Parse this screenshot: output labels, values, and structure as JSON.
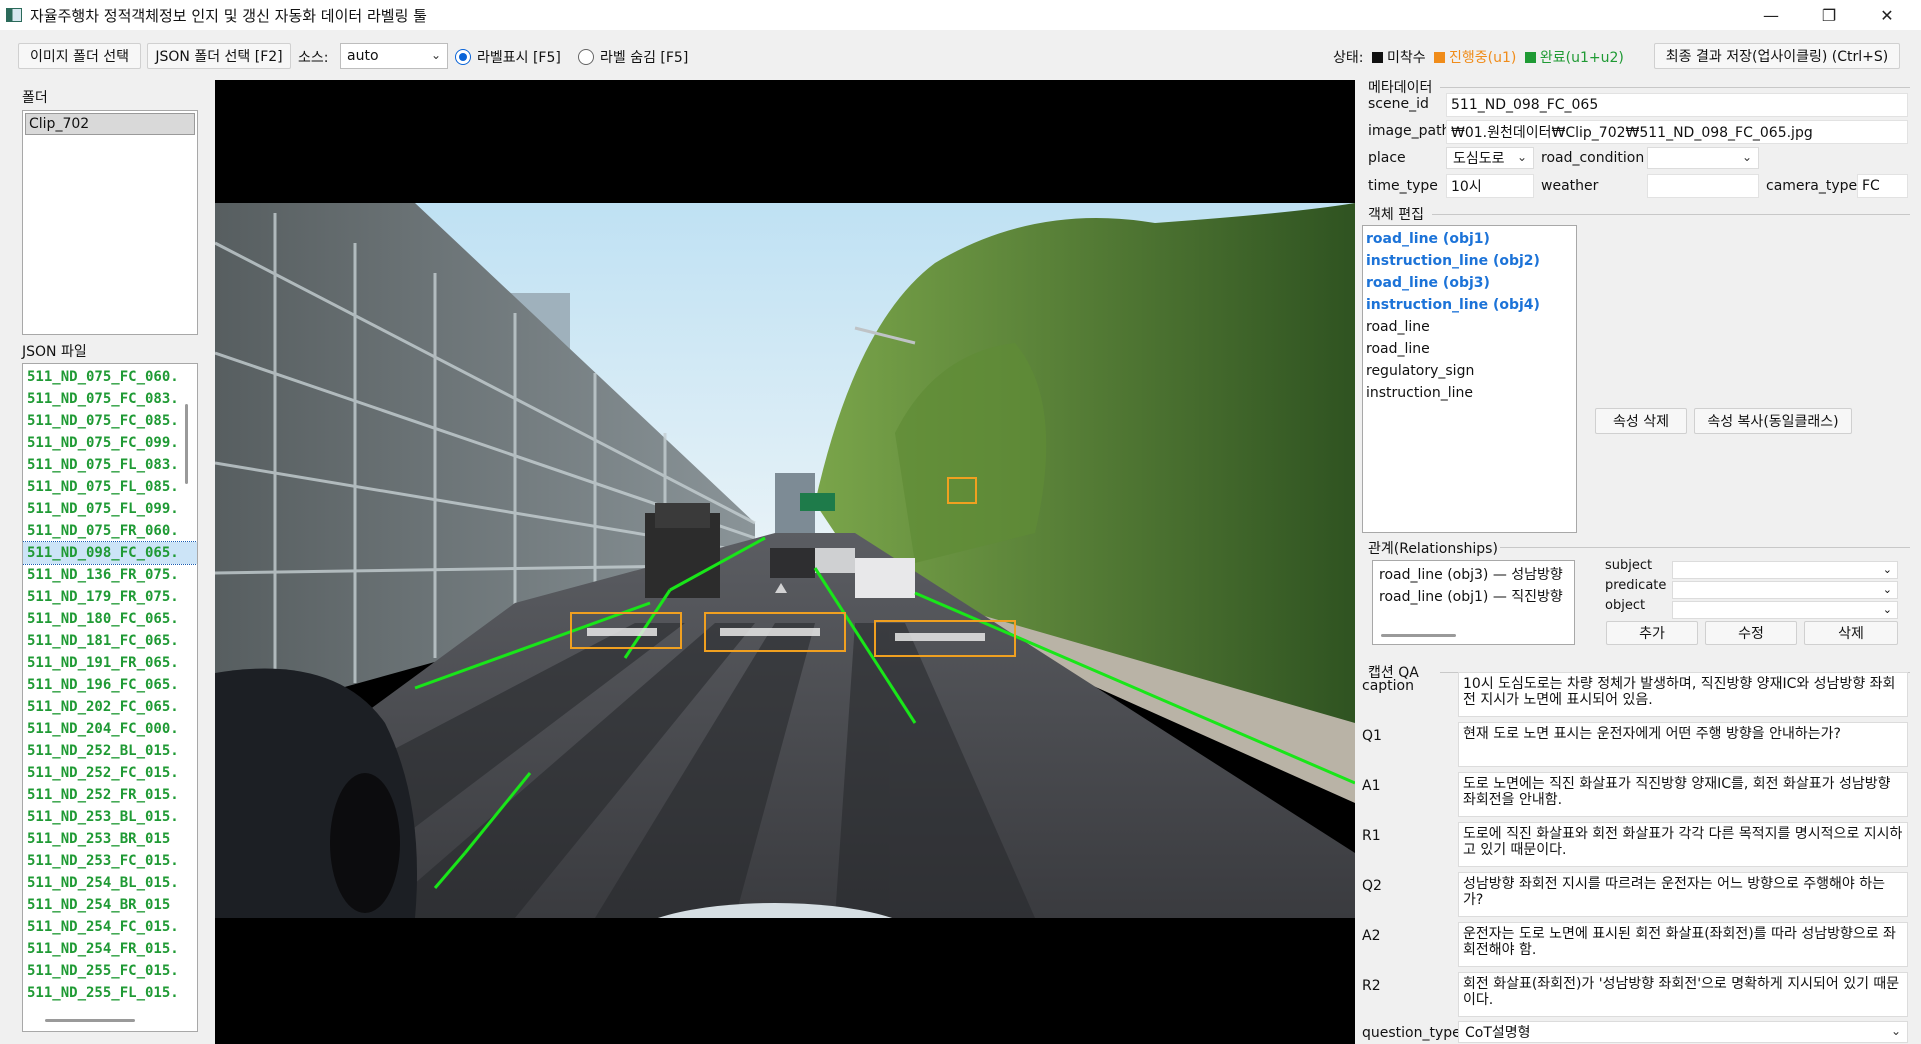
{
  "window": {
    "title": "자율주행차 정적객체정보 인지 및 갱신 자동화 데이터 라벨링 툴",
    "minimize": "—",
    "restore": "❐",
    "close": "✕"
  },
  "toolbar": {
    "image_folder_button": "이미지 폴더 선택",
    "json_folder_button": "JSON 폴더 선택 [F2]",
    "source_label": "소스:",
    "source_value": "auto",
    "radio_show": "라벨표시 [F5]",
    "radio_hide": "라벨 숨김 [F5]",
    "status_label": "상태:",
    "status_todo": "미착수",
    "status_progress": "진행중(u1)",
    "status_done": "완료(u1+u2)",
    "save_button": "최종 결과 저장(업사이클링) (Ctrl+S)",
    "colors": {
      "todo": "#111111",
      "progress": "#f08c1a",
      "done": "#1f9a34",
      "radio_on": "#0a64d8"
    }
  },
  "left": {
    "folder_label": "폴더",
    "folders": [
      "Clip_702"
    ],
    "json_label": "JSON 파일",
    "json_files": [
      "511_ND_075_FC_060.",
      "511_ND_075_FC_083.",
      "511_ND_075_FC_085.",
      "511_ND_075_FC_099.",
      "511_ND_075_FL_083.",
      "511_ND_075_FL_085.",
      "511_ND_075_FL_099.",
      "511_ND_075_FR_060.",
      "511_ND_098_FC_065.",
      "511_ND_136_FR_075.",
      "511_ND_179_FR_075.",
      "511_ND_180_FC_065.",
      "511_ND_181_FC_065.",
      "511_ND_191_FR_065.",
      "511_ND_196_FC_065.",
      "511_ND_202_FC_065.",
      "511_ND_204_FC_000.",
      "511_ND_252_BL_015.",
      "511_ND_252_FC_015.",
      "511_ND_252_FR_015.",
      "511_ND_253_BL_015.",
      "511_ND_253_BR_015",
      "511_ND_253_FC_015.",
      "511_ND_254_BL_015.",
      "511_ND_254_BR_015",
      "511_ND_254_FC_015.",
      "511_ND_254_FR_015.",
      "511_ND_255_FC_015.",
      "511_ND_255_FL_015."
    ],
    "selected_index": 8
  },
  "meta": {
    "section_label": "메타데이터",
    "scene_id_label": "scene_id",
    "scene_id": "511_ND_098_FC_065",
    "image_path_label": "image_path",
    "image_path": "₩01.원천데이터₩Clip_702₩511_ND_098_FC_065.jpg",
    "place_label": "place",
    "place": "도심도로",
    "road_condition_label": "road_condition",
    "road_condition": "",
    "time_type_label": "time_type",
    "time_type": "10시",
    "weather_label": "weather",
    "weather": "",
    "camera_type_label": "camera_type",
    "camera_type": "FC"
  },
  "objects": {
    "section_label": "객체 편집",
    "items": [
      {
        "label": "road_line (obj1)",
        "highlight": true
      },
      {
        "label": "instruction_line (obj2)",
        "highlight": true
      },
      {
        "label": "road_line (obj3)",
        "highlight": true
      },
      {
        "label": "instruction_line (obj4)",
        "highlight": true
      },
      {
        "label": "road_line",
        "highlight": false
      },
      {
        "label": "road_line",
        "highlight": false
      },
      {
        "label": "regulatory_sign",
        "highlight": false
      },
      {
        "label": "instruction_line",
        "highlight": false
      }
    ],
    "delete_attr_button": "속성 삭제",
    "copy_attr_button": "속성 복사(동일클래스)"
  },
  "relations": {
    "section_label": "관계(Relationships)",
    "items": [
      "road_line (obj3) — 성남방향",
      "road_line (obj1) — 직진방향"
    ],
    "subject_label": "subject",
    "predicate_label": "predicate",
    "object_label": "object",
    "add_button": "추가",
    "edit_button": "수정",
    "delete_button": "삭제"
  },
  "qa": {
    "section_label": "캡션  QA",
    "caption_label": "caption",
    "caption": "10시 도심도로는 차량 정체가 발생하며, 직진방향 양재IC와 성남방향 좌회전 지시가 노면에 표시되어 있음.",
    "q1_label": "Q1",
    "q1": "현재 도로 노면 표시는 운전자에게 어떤 주행 방향을 안내하는가?",
    "a1_label": "A1",
    "a1": "도로 노면에는 직진 화살표가 직진방향 양재IC를, 회전 화살표가 성남방향 좌회전을 안내함.",
    "r1_label": "R1",
    "r1": "도로에 직진 화살표와 회전 화살표가 각각 다른 목적지를 명시적으로 지시하고 있기 때문이다.",
    "q2_label": "Q2",
    "q2": "성남방향 좌회전 지시를 따르려는 운전자는 어느 방향으로 주행해야 하는가?",
    "a2_label": "A2",
    "a2": "운전자는 도로 노면에 표시된 회전 화살표(좌회전)를 따라 성남방향으로 좌회전해야 함.",
    "r2_label": "R2",
    "r2": "회전 화살표(좌회전)가 '성남방향 좌회전'으로 명확하게 지시되어 있기 때문이다.",
    "question_type_label": "question_type",
    "question_type": "CoT설명형"
  },
  "annotation_colors": {
    "box": "#f0a020",
    "line": "#19e619"
  }
}
